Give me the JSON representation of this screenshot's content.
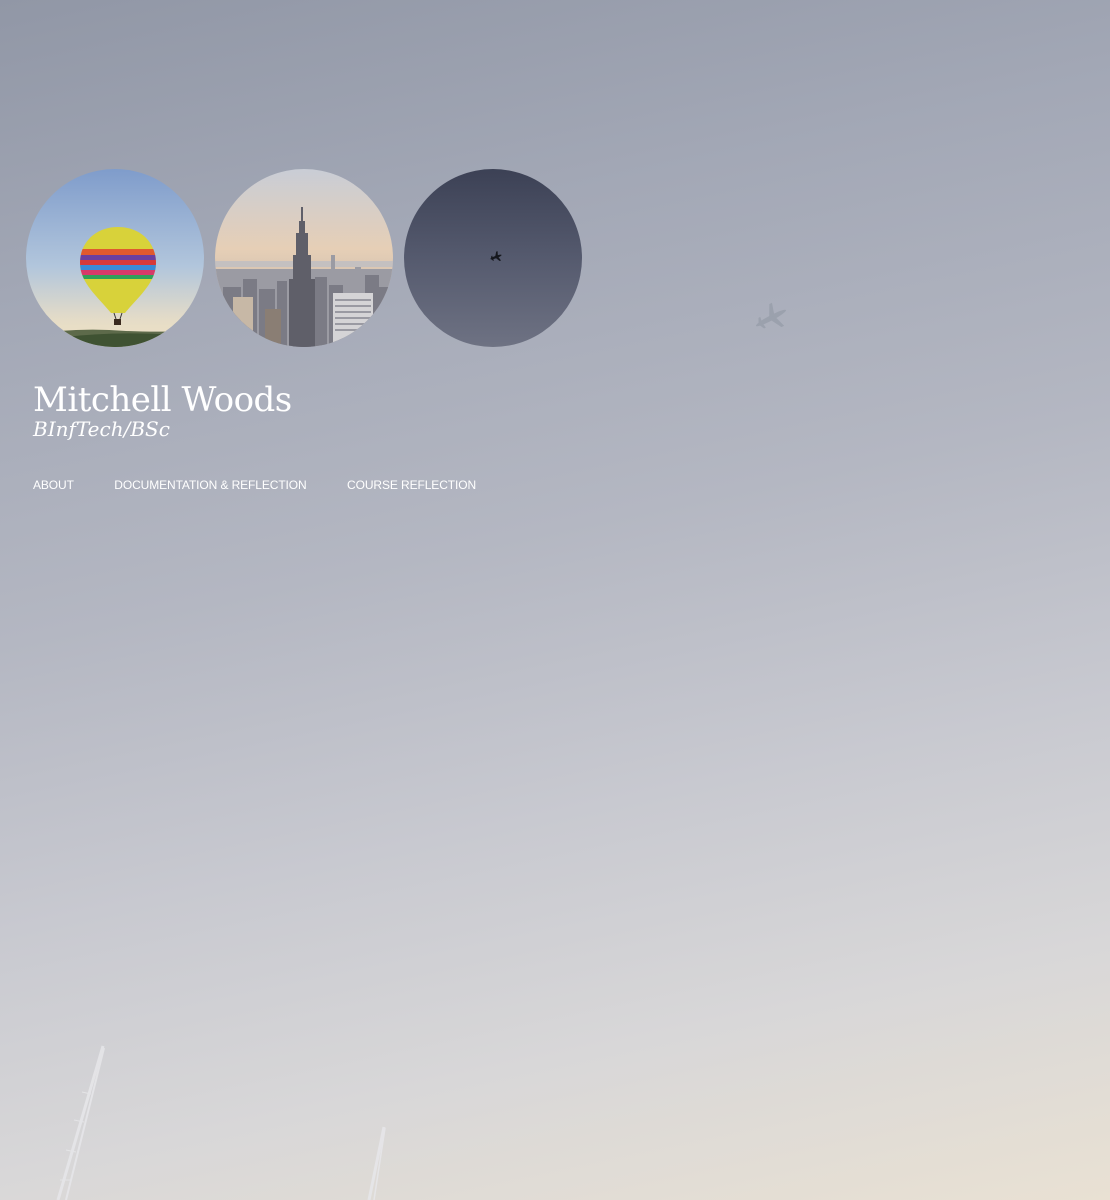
{
  "header": {
    "title": "Mitchell Woods",
    "subtitle": "BInfTech/BSc"
  },
  "header_images": [
    {
      "name": "hot-air-balloon-photo"
    },
    {
      "name": "city-skyline-photo"
    },
    {
      "name": "airplane-sky-photo"
    }
  ],
  "nav": {
    "items": [
      {
        "label": "ABOUT"
      },
      {
        "label": "DOCUMENTATION & REFLECTION"
      },
      {
        "label": "COURSE REFLECTION"
      }
    ]
  },
  "background": {
    "name": "sky-with-airplane-background",
    "colors": [
      "#9197a6",
      "#b4b7c2",
      "#d8d7d8",
      "#e9e1d3"
    ]
  }
}
